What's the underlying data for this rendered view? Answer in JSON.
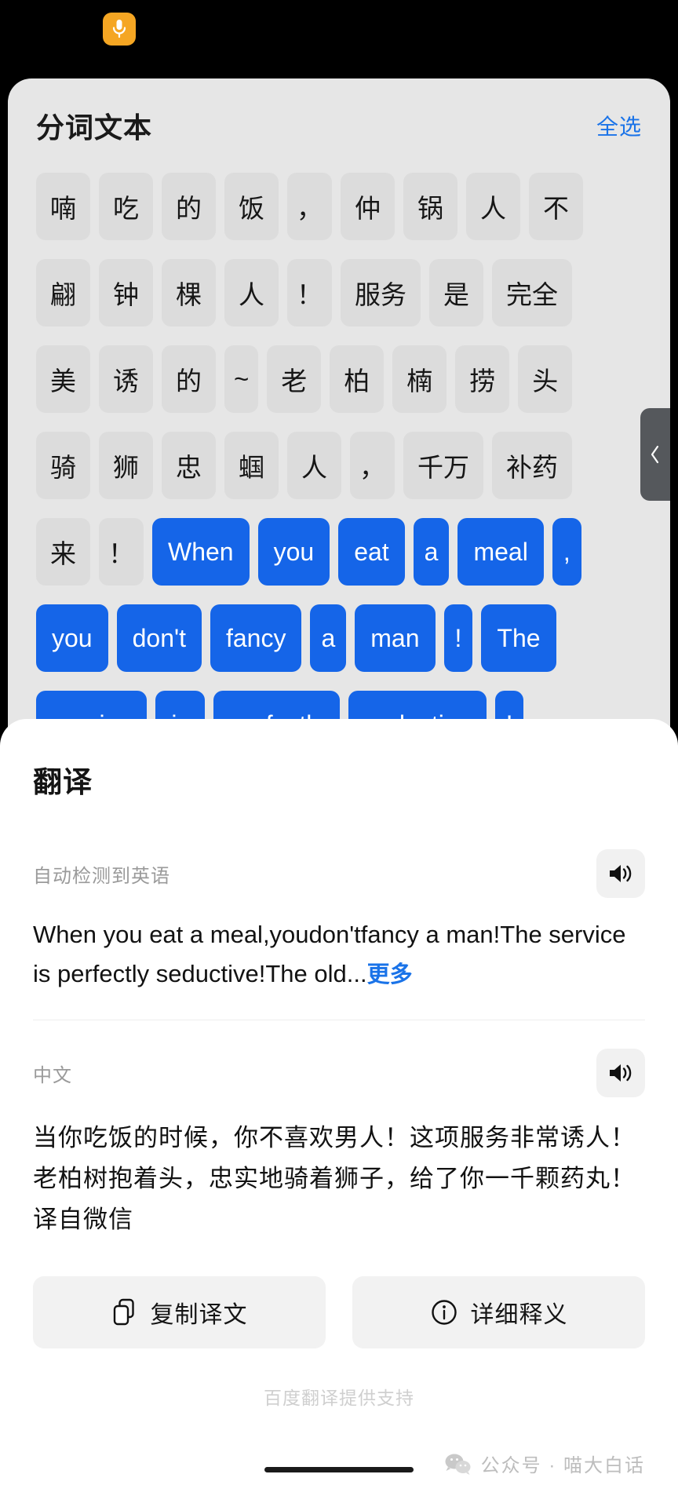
{
  "statusbar": {
    "mic_icon": "microphone-icon"
  },
  "segmentation": {
    "title": "分词文本",
    "select_all": "全选",
    "drawer_handle_icon": "chevron-left-icon",
    "rows": [
      [
        {
          "t": "喃",
          "sel": false
        },
        {
          "t": "吃",
          "sel": false
        },
        {
          "t": "的",
          "sel": false
        },
        {
          "t": "饭",
          "sel": false
        },
        {
          "t": "，",
          "sel": false,
          "narrow": true
        },
        {
          "t": "仲",
          "sel": false
        },
        {
          "t": "锅",
          "sel": false
        },
        {
          "t": "人",
          "sel": false
        },
        {
          "t": "不",
          "sel": false
        }
      ],
      [
        {
          "t": "翩",
          "sel": false
        },
        {
          "t": "钟",
          "sel": false
        },
        {
          "t": "棵",
          "sel": false
        },
        {
          "t": "人",
          "sel": false
        },
        {
          "t": "！",
          "sel": false,
          "narrow": true
        },
        {
          "t": "服务",
          "sel": false
        },
        {
          "t": "是",
          "sel": false
        },
        {
          "t": "完全",
          "sel": false
        }
      ],
      [
        {
          "t": "美",
          "sel": false
        },
        {
          "t": "诱",
          "sel": false
        },
        {
          "t": "的",
          "sel": false
        },
        {
          "t": "~",
          "sel": false,
          "narrow": true
        },
        {
          "t": "老",
          "sel": false
        },
        {
          "t": "柏",
          "sel": false
        },
        {
          "t": "楠",
          "sel": false
        },
        {
          "t": "捞",
          "sel": false
        },
        {
          "t": "头",
          "sel": false
        }
      ],
      [
        {
          "t": "骑",
          "sel": false
        },
        {
          "t": "狮",
          "sel": false
        },
        {
          "t": "忠",
          "sel": false
        },
        {
          "t": "蝈",
          "sel": false
        },
        {
          "t": "人",
          "sel": false
        },
        {
          "t": "，",
          "sel": false,
          "narrow": true
        },
        {
          "t": "千万",
          "sel": false
        },
        {
          "t": "补药",
          "sel": false
        }
      ],
      [
        {
          "t": "来",
          "sel": false
        },
        {
          "t": "！",
          "sel": false,
          "narrow": true
        },
        {
          "t": "When",
          "sel": true
        },
        {
          "t": "you",
          "sel": true
        },
        {
          "t": "eat",
          "sel": true
        },
        {
          "t": "a",
          "sel": true,
          "narrow": true
        },
        {
          "t": "meal",
          "sel": true
        },
        {
          "t": ",",
          "sel": true,
          "narrow": true
        }
      ],
      [
        {
          "t": "you",
          "sel": true
        },
        {
          "t": "don't",
          "sel": true
        },
        {
          "t": "fancy",
          "sel": true
        },
        {
          "t": "a",
          "sel": true,
          "narrow": true
        },
        {
          "t": "man",
          "sel": true
        },
        {
          "t": "!",
          "sel": true,
          "narrow": true
        },
        {
          "t": "The",
          "sel": true
        }
      ],
      [
        {
          "t": "service",
          "sel": true
        },
        {
          "t": "is",
          "sel": true
        },
        {
          "t": "perfectly",
          "sel": true
        },
        {
          "t": "seductive",
          "sel": true
        },
        {
          "t": "!",
          "sel": true,
          "narrow": true
        }
      ]
    ]
  },
  "translation": {
    "title": "翻译",
    "source": {
      "lang_label": "自动检测到英语",
      "speaker_icon": "speaker-icon",
      "text": "When you eat a meal,youdon'tfancy a man!The service is perfectly seductive!The old...",
      "more_label": "更多"
    },
    "target": {
      "lang_label": "中文",
      "speaker_icon": "speaker-icon",
      "text": "当你吃饭的时候，你不喜欢男人！这项服务非常诱人！老柏树抱着头，忠实地骑着狮子，给了你一千颗药丸！译自微信"
    },
    "actions": [
      {
        "label": "复制译文",
        "icon": "copy-icon"
      },
      {
        "label": "详细释义",
        "icon": "info-icon"
      }
    ],
    "powered_by": "百度翻译提供支持"
  },
  "watermark": {
    "icon": "wechat-icon",
    "text": "公众号 · 喵大白话"
  },
  "colors": {
    "accent_blue": "#1a73e8",
    "chip_selected": "#1565E8",
    "chip_idle": "#DCDCDC",
    "card_bg": "#E6E6E6",
    "sheet_bg": "#FFFFFF",
    "mic_badge": "#F5A623"
  }
}
